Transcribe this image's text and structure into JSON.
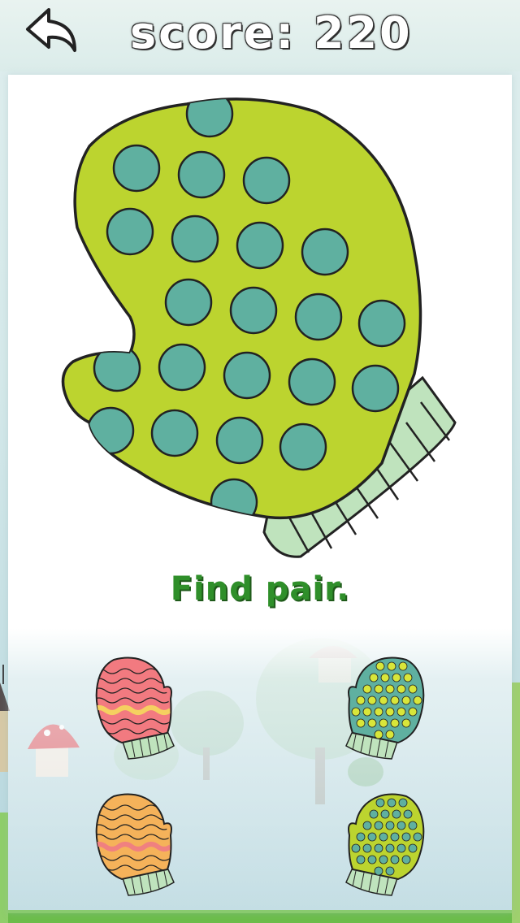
{
  "header": {
    "back_icon": "curved-back-arrow-icon",
    "score_text": "score: 220"
  },
  "prompt": "Find pair.",
  "target_mitten": {
    "pattern": "polka-dots",
    "body_color": "#bcd42f",
    "dot_color": "#5fb0a0",
    "cuff_color": "#bfe3bd"
  },
  "choices": [
    {
      "id": "choice-pink-wavy",
      "pattern": "wavy-stripes",
      "body_color": "#f27a80",
      "stripe_color": "#f5d060",
      "cuff_color": "#bfe3bd"
    },
    {
      "id": "choice-teal-dots",
      "pattern": "polka-dots",
      "body_color": "#5fb0a0",
      "dot_color": "#d8e63a",
      "cuff_color": "#bfe3bd"
    },
    {
      "id": "choice-orange-wavy",
      "pattern": "wavy-stripes",
      "body_color": "#f5b25a",
      "stripe_color": "#f08080",
      "cuff_color": "#bfe3bd"
    },
    {
      "id": "choice-green-dots",
      "pattern": "polka-dots",
      "body_color": "#bcd42f",
      "dot_color": "#5fb0a0",
      "cuff_color": "#bfe3bd"
    }
  ]
}
